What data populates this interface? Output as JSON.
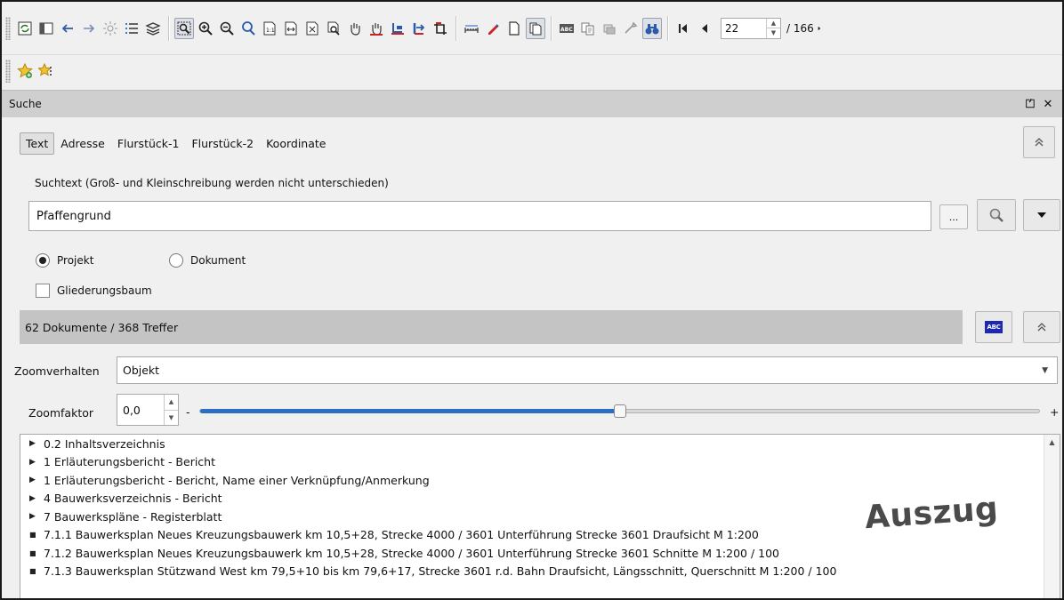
{
  "toolbar": {
    "page_current": "22",
    "page_total": "/ 166"
  },
  "dock": {
    "title": "Suche",
    "float_glyph": "⏍",
    "close_glyph": "✕"
  },
  "tabs": [
    {
      "label": "Text",
      "active": true
    },
    {
      "label": "Adresse"
    },
    {
      "label": "Flurstück-1"
    },
    {
      "label": "Flurstück-2"
    },
    {
      "label": "Koordinate"
    }
  ],
  "search": {
    "hint": "Suchtext (Groß- und Kleinschreibung werden nicht unterschieden)",
    "value": "Pfaffengrund",
    "more_label": "..."
  },
  "scope": {
    "projekt_label": "Projekt",
    "dokument_label": "Dokument",
    "selected": "projekt"
  },
  "gliederung": {
    "label": "Gliederungsbaum",
    "checked": false
  },
  "results": {
    "summary": "62 Dokumente / 368 Treffer",
    "abc_badge": "ABC"
  },
  "zoom": {
    "mode_label": "Zoomverhalten",
    "mode_value": "Objekt",
    "factor_label": "Zoomfaktor",
    "factor_value": "0,0",
    "minus": "-",
    "plus": "+",
    "slider_fraction": 0.5
  },
  "tree_items": [
    {
      "type": "node",
      "label": "0.2 Inhaltsverzeichnis"
    },
    {
      "type": "node",
      "label": "1 Erläuterungsbericht - Bericht"
    },
    {
      "type": "node",
      "label": "1 Erläuterungsbericht - Bericht, Name einer Verknüpfung/Anmerkung"
    },
    {
      "type": "node",
      "label": "4 Bauwerksverzeichnis - Bericht"
    },
    {
      "type": "node",
      "label": "7 Bauwerkspläne - Registerblatt"
    },
    {
      "type": "leaf",
      "label": "7.1.1 Bauwerksplan Neues Kreuzungsbauwerk km 10,5+28, Strecke 4000 / 3601 Unterführung Strecke 3601 Draufsicht   M 1:200"
    },
    {
      "type": "leaf",
      "label": "7.1.2 Bauwerksplan Neues Kreuzungsbauwerk km 10,5+28, Strecke 4000 / 3601 Unterführung Strecke 3601 Schnitte   M 1:200 / 100"
    },
    {
      "type": "leaf",
      "label": "7.1.3 Bauwerksplan Stützwand West km 79,5+10 bis km 79,6+17, Strecke 3601 r.d. Bahn Draufsicht, Längsschnitt, Querschnitt   M 1:200 / 100"
    }
  ],
  "watermark": "Auszug",
  "colors": {
    "accent": "#2b6fc4",
    "results_bar": "#c4c4c4",
    "dock_title": "#cfcfcf"
  }
}
